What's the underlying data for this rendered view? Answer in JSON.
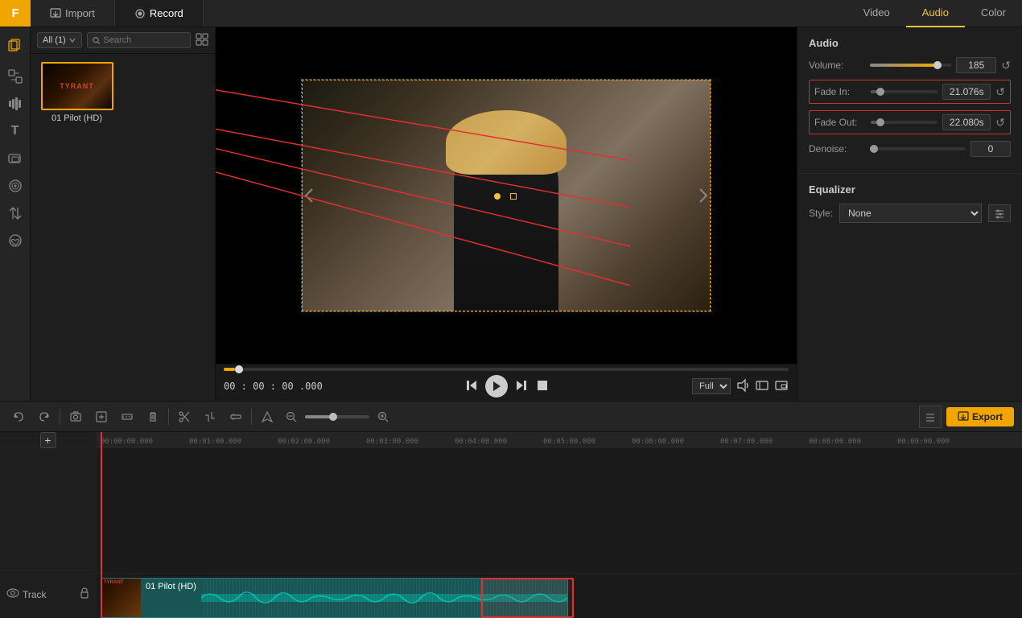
{
  "app": {
    "logo": "F",
    "logo_bg": "#f0a500"
  },
  "top_tabs": [
    {
      "id": "import",
      "label": "Import",
      "icon": "import",
      "active": false
    },
    {
      "id": "record",
      "label": "Record",
      "icon": "record",
      "active": true
    }
  ],
  "panel_tabs": [
    {
      "id": "video",
      "label": "Video",
      "active": false
    },
    {
      "id": "audio",
      "label": "Audio",
      "active": true
    },
    {
      "id": "color",
      "label": "Color",
      "active": false
    }
  ],
  "media_panel": {
    "filter_label": "All (1)",
    "search_placeholder": "Search",
    "items": [
      {
        "id": "pilot",
        "name": "01 Pilot (HD)",
        "thumb": "pilot"
      }
    ]
  },
  "preview": {
    "time": "00 : 00 : 00 .000",
    "quality": "Full",
    "progress_pct": 2
  },
  "audio_panel": {
    "section_title": "Audio",
    "volume_label": "Volume:",
    "volume_value": "185",
    "volume_pct": 80,
    "fade_in_label": "Fade In:",
    "fade_in_value": "21.076s",
    "fade_out_label": "Fade Out:",
    "fade_out_value": "22.080s",
    "denoise_label": "Denoise:",
    "denoise_value": "0",
    "equalizer_title": "Equalizer",
    "style_label": "Style:",
    "style_value": "None"
  },
  "timeline": {
    "track_name": "Track",
    "clip_name": "01 Pilot (HD)",
    "ruler_marks": [
      "00:00:00.000",
      "00:01:00.000",
      "00:02:00.000",
      "00:03:00.000",
      "00:04:00.000",
      "00:05:00.000",
      "00:06:00.000",
      "00:07:00.000",
      "00:08:00.000",
      "00:09:00.000"
    ]
  },
  "toolbar": {
    "export_label": "Export",
    "undo_label": "Undo",
    "redo_label": "Redo"
  }
}
